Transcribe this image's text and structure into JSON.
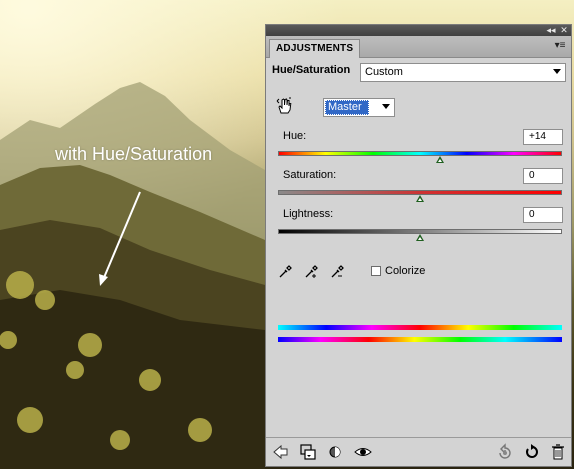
{
  "caption": "with Hue/Saturation",
  "panel": {
    "tab_label": "ADJUSTMENTS",
    "collapse_icon": "double-chevron-left-icon",
    "close_icon": "close-icon",
    "menu_icon": "panel-menu-icon",
    "section_title": "Hue/Saturation",
    "preset_value": "Custom",
    "channel_value": "Master",
    "hue": {
      "label": "Hue:",
      "value": "+14",
      "position": 0.57
    },
    "saturation": {
      "label": "Saturation:",
      "value": "0",
      "position": 0.5
    },
    "lightness": {
      "label": "Lightness:",
      "value": "0",
      "position": 0.5
    },
    "colorize_label": "Colorize",
    "colorize_checked": false,
    "eyedroppers": [
      "eyedropper-icon",
      "eyedropper-add-icon",
      "eyedropper-subtract-icon"
    ],
    "bottom_icons": [
      "back-arrow-icon",
      "clip-to-layer-icon",
      "layer-mask-icon",
      "visibility-eye-icon",
      "view-previous-state-icon",
      "reset-icon",
      "trash-icon"
    ]
  }
}
